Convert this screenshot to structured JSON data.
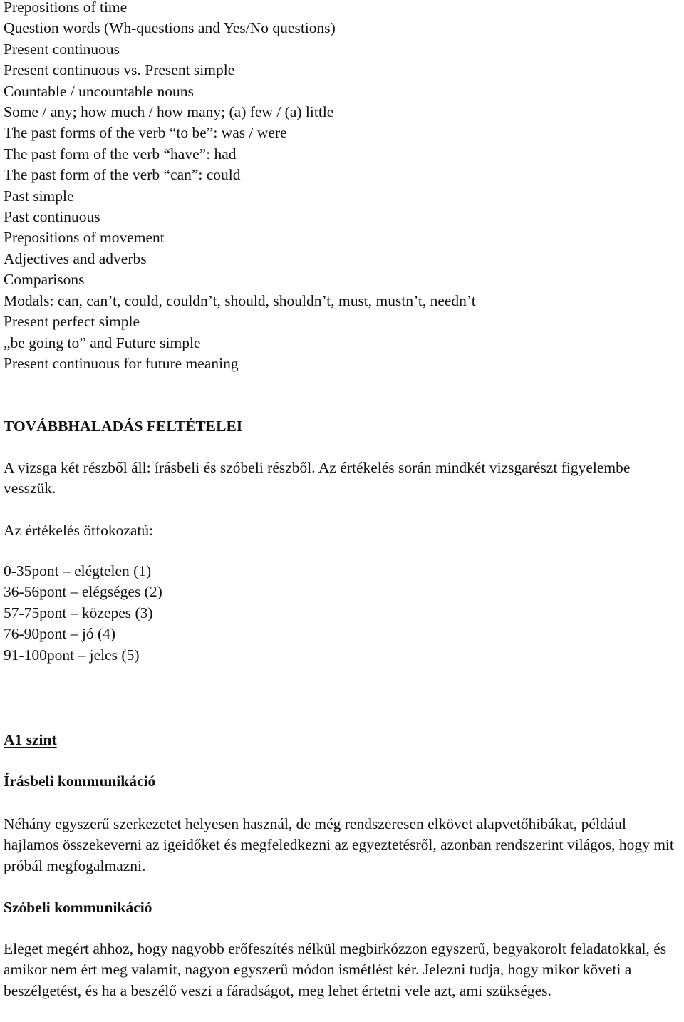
{
  "topics": [
    "Prepositions of time",
    "Question words (Wh-questions and Yes/No questions)",
    "Present continuous",
    "Present continuous vs. Present simple",
    "Countable / uncountable nouns",
    "Some / any; how much / how many; (a) few / (a) little",
    "The past forms of the verb “to be”: was / were",
    "The past form of the verb “have”: had",
    "The past form of the verb “can”: could",
    "Past simple",
    "Past continuous",
    "Prepositions of movement",
    "Adjectives and adverbs",
    "Comparisons",
    "Modals: can, can’t, could, couldn’t, should, shouldn’t, must, mustn’t, needn’t",
    "Present perfect simple",
    "„be going to” and Future simple",
    "Present continuous for future meaning"
  ],
  "progression": {
    "heading": "TOVÁBBHALADÁS FELTÉTELEI",
    "exam_description": "A vizsga két részből áll: írásbeli és szóbeli részből. Az értékelés során mindkét vizsgarészt figyelembe vesszük.",
    "grading_intro": "Az értékelés ötfokozatú:",
    "grades": [
      {
        "range": "0-35pont",
        "label": "elégtelen",
        "grade": "(1)"
      },
      {
        "range": "36-56pont",
        "label": "elégséges",
        "grade": "(2)"
      },
      {
        "range": "57-75pont",
        "label": "közepes",
        "grade": "(3)"
      },
      {
        "range": "76-90pont",
        "label": "jó",
        "grade": "(4)"
      },
      {
        "range": "91-100pont",
        "label": "jeles",
        "grade": "(5)"
      }
    ],
    "grade_separator": "–"
  },
  "level": {
    "title": "A1 szint",
    "written": {
      "heading": "Írásbeli kommunikáció",
      "text": "Néhány egyszerű szerkezetet helyesen használ, de még rendszeresen elkövet alapvetőhibákat, például hajlamos összekeverni az igeidőket és megfeledkezni az egyeztetésről, azonban rendszerint világos, hogy mit próbál megfogalmazni."
    },
    "oral": {
      "heading": "Szóbeli kommunikáció",
      "text": "Eleget megért ahhoz, hogy nagyobb erőfeszítés nélkül megbirkózzon egyszerű, begyakorolt feladatokkal, és amikor nem ért meg valamit, nagyon egyszerű módon ismétlést kér. Jelezni tudja, hogy mikor követi a beszélgetést, és ha a beszélő veszi a fáradságot, meg lehet értetni vele azt, ami szükséges."
    }
  }
}
